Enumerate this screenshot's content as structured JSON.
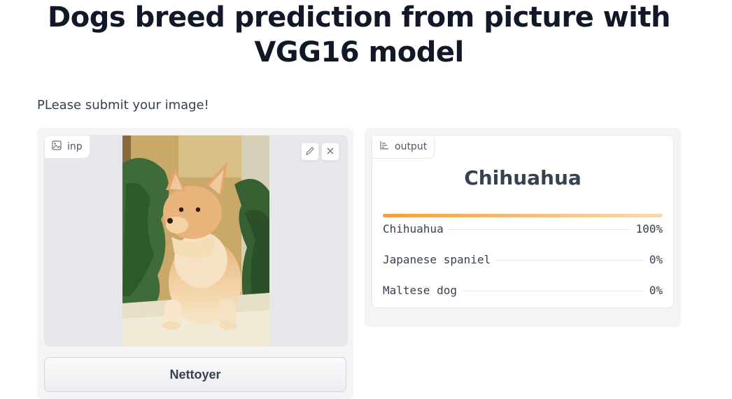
{
  "page": {
    "title": "Dogs breed prediction from picture with VGG16 model",
    "description": "PLease submit your image!"
  },
  "input": {
    "label": "inp",
    "label_icon": "image-icon",
    "edit_icon": "pencil-icon",
    "clear_icon": "close-icon",
    "clear_button": "Nettoyer"
  },
  "output": {
    "label": "output",
    "label_icon": "bar-chart-icon",
    "prediction": "Chihuahua",
    "top_confidence": 1.0,
    "results": [
      {
        "label": "Chihuahua",
        "value": "100%"
      },
      {
        "label": "Japanese spaniel",
        "value": "0%"
      },
      {
        "label": "Maltese dog",
        "value": "0%"
      }
    ]
  },
  "colors": {
    "bar_start": "#f59e3b",
    "bar_end": "#fcd9b0",
    "panel_bg": "#f3f4f6"
  }
}
